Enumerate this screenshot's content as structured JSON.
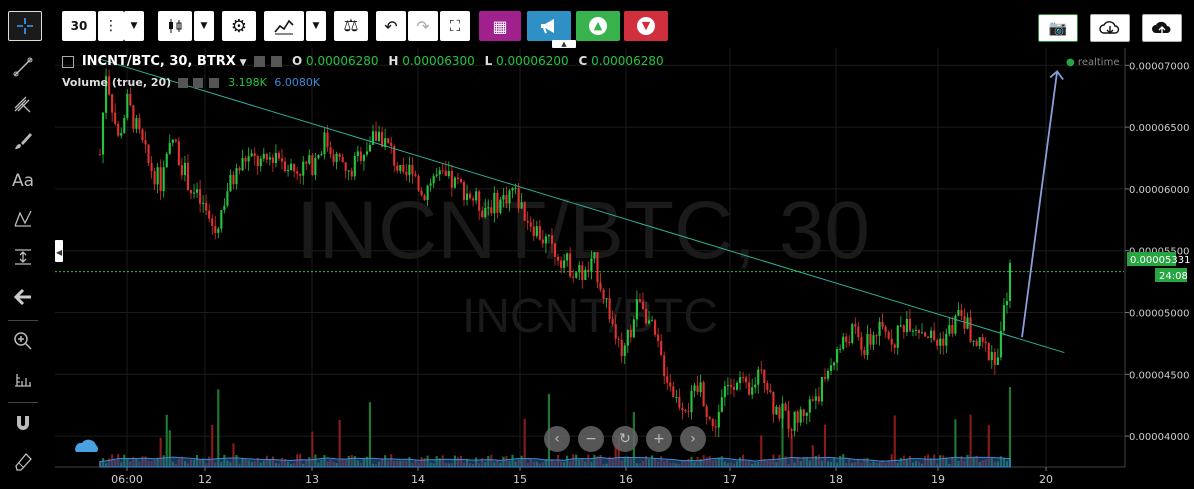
{
  "toolbar": {
    "interval": "30",
    "colors": {
      "purple": "#a0208e",
      "blue": "#2e90c5",
      "green": "#37b24d",
      "red": "#d0303d"
    }
  },
  "legend": {
    "symbol": "INCNT/BTC, 30, BTRX",
    "o_label": "O",
    "o": "0.00006280",
    "h_label": "H",
    "h": "0.00006300",
    "l_label": "L",
    "l": "0.00006200",
    "c_label": "C",
    "c": "0.00006280",
    "volume_label": "Volume (true, 20)",
    "volume_value": "3.198K",
    "volume_ma": "6.0080K",
    "realtime": "realtime"
  },
  "watermark": {
    "main": "INCNT/BTC, 30",
    "sub": "INCNT/BTC"
  },
  "chart_data": {
    "type": "candlestick",
    "price_axis": [
      "0.00007000",
      "0.00006500",
      "0.00006000",
      "0.00005500",
      "0.00005000",
      "0.00004500",
      "0.00004000"
    ],
    "time_axis": [
      "06:00",
      "12",
      "13",
      "14",
      "15",
      "16",
      "17",
      "18",
      "19",
      "20"
    ],
    "current_price": "0.00005331",
    "countdown": "24:08",
    "ylim": [
      3.75e-05,
      7.14e-05
    ],
    "close_path": [
      [
        6.28e-05,
        0
      ],
      [
        6.95e-05,
        2
      ],
      [
        6.4e-05,
        6
      ],
      [
        6.7e-05,
        9
      ],
      [
        6.35e-05,
        14
      ],
      [
        6.2e-05,
        16
      ],
      [
        6.05e-05,
        20
      ],
      [
        6.4e-05,
        24
      ],
      [
        6e-05,
        30
      ],
      [
        5.85e-05,
        34
      ],
      [
        5.65e-05,
        38
      ],
      [
        6e-05,
        42
      ],
      [
        6.25e-05,
        48
      ],
      [
        6.2e-05,
        54
      ],
      [
        6.3e-05,
        58
      ],
      [
        6.15e-05,
        64
      ],
      [
        6.2e-05,
        70
      ],
      [
        6.4e-05,
        74
      ],
      [
        6.25e-05,
        78
      ],
      [
        6.1e-05,
        82
      ],
      [
        6.3e-05,
        86
      ],
      [
        6.45e-05,
        92
      ],
      [
        6.3e-05,
        96
      ],
      [
        6.05e-05,
        100
      ],
      [
        6.2e-05,
        103
      ],
      [
        5.95e-05,
        106
      ],
      [
        6.1e-05,
        110
      ],
      [
        6.05e-05,
        116
      ],
      [
        6e-05,
        120
      ],
      [
        5.85e-05,
        126
      ],
      [
        5.9e-05,
        132
      ],
      [
        6e-05,
        136
      ],
      [
        5.8e-05,
        140
      ],
      [
        5.6e-05,
        146
      ],
      [
        5.5e-05,
        150
      ],
      [
        5.35e-05,
        156
      ],
      [
        5.3e-05,
        160
      ],
      [
        5.4e-05,
        163
      ],
      [
        5e-05,
        168
      ],
      [
        4.8e-05,
        170
      ],
      [
        4.6e-05,
        172
      ],
      [
        4.95e-05,
        176
      ],
      [
        5.15e-05,
        178
      ],
      [
        4.85e-05,
        182
      ],
      [
        4.55e-05,
        186
      ],
      [
        4.3e-05,
        190
      ],
      [
        4.25e-05,
        194
      ],
      [
        4.4e-05,
        198
      ],
      [
        4.05e-05,
        202
      ],
      [
        4.35e-05,
        206
      ],
      [
        4.5e-05,
        210
      ],
      [
        4.3e-05,
        214
      ],
      [
        4.6e-05,
        218
      ],
      [
        4.25e-05,
        222
      ],
      [
        4.1e-05,
        228
      ],
      [
        4.2e-05,
        232
      ],
      [
        4.4e-05,
        238
      ],
      [
        4.65e-05,
        242
      ],
      [
        4.85e-05,
        248
      ],
      [
        4.7e-05,
        252
      ],
      [
        4.85e-05,
        256
      ],
      [
        4.8e-05,
        262
      ],
      [
        4.95e-05,
        266
      ],
      [
        4.85e-05,
        272
      ],
      [
        4.75e-05,
        276
      ],
      [
        4.85e-05,
        280
      ],
      [
        5e-05,
        284
      ],
      [
        4.75e-05,
        288
      ],
      [
        4.7e-05,
        292
      ],
      [
        4.65e-05,
        296
      ],
      [
        5.331e-05,
        300
      ]
    ],
    "trendline": [
      [
        7.05e-05,
        0
      ],
      [
        4.7e-05,
        310
      ]
    ],
    "projection_arrow": [
      [
        4.8e-05,
        300
      ],
      [
        6.95e-05,
        303
      ]
    ]
  }
}
